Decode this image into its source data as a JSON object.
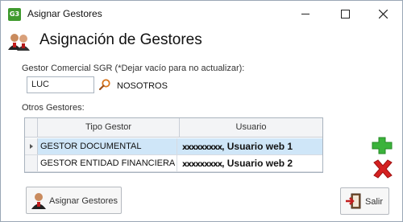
{
  "window": {
    "app_icon_text": "G3",
    "title": "Asignar Gestores"
  },
  "header": {
    "title": "Asignación de Gestores"
  },
  "gestor_comercial": {
    "label": "Gestor Comercial SGR (*Dejar vacío para no actualizar):",
    "value": "LUC",
    "name": "NOSOTROS"
  },
  "otros_gestores": {
    "label": "Otros Gestores:",
    "columns": [
      "Tipo Gestor",
      "Usuario"
    ],
    "rows": [
      {
        "tipo": "GESTOR DOCUMENTAL",
        "usuario_redacted": "xxxxxxxxx",
        "usuario": "Usuario web 1",
        "selected": true
      },
      {
        "tipo": "GESTOR ENTIDAD FINANCIERA",
        "usuario_redacted": "xxxxxxxxx",
        "usuario": "Usuario web 2",
        "selected": false
      }
    ]
  },
  "buttons": {
    "asignar": "Asignar Gestores",
    "salir": "Salir"
  },
  "colors": {
    "selected_row": "#cfe6f8",
    "add_green": "#3bb33b",
    "delete_red": "#d42020"
  }
}
